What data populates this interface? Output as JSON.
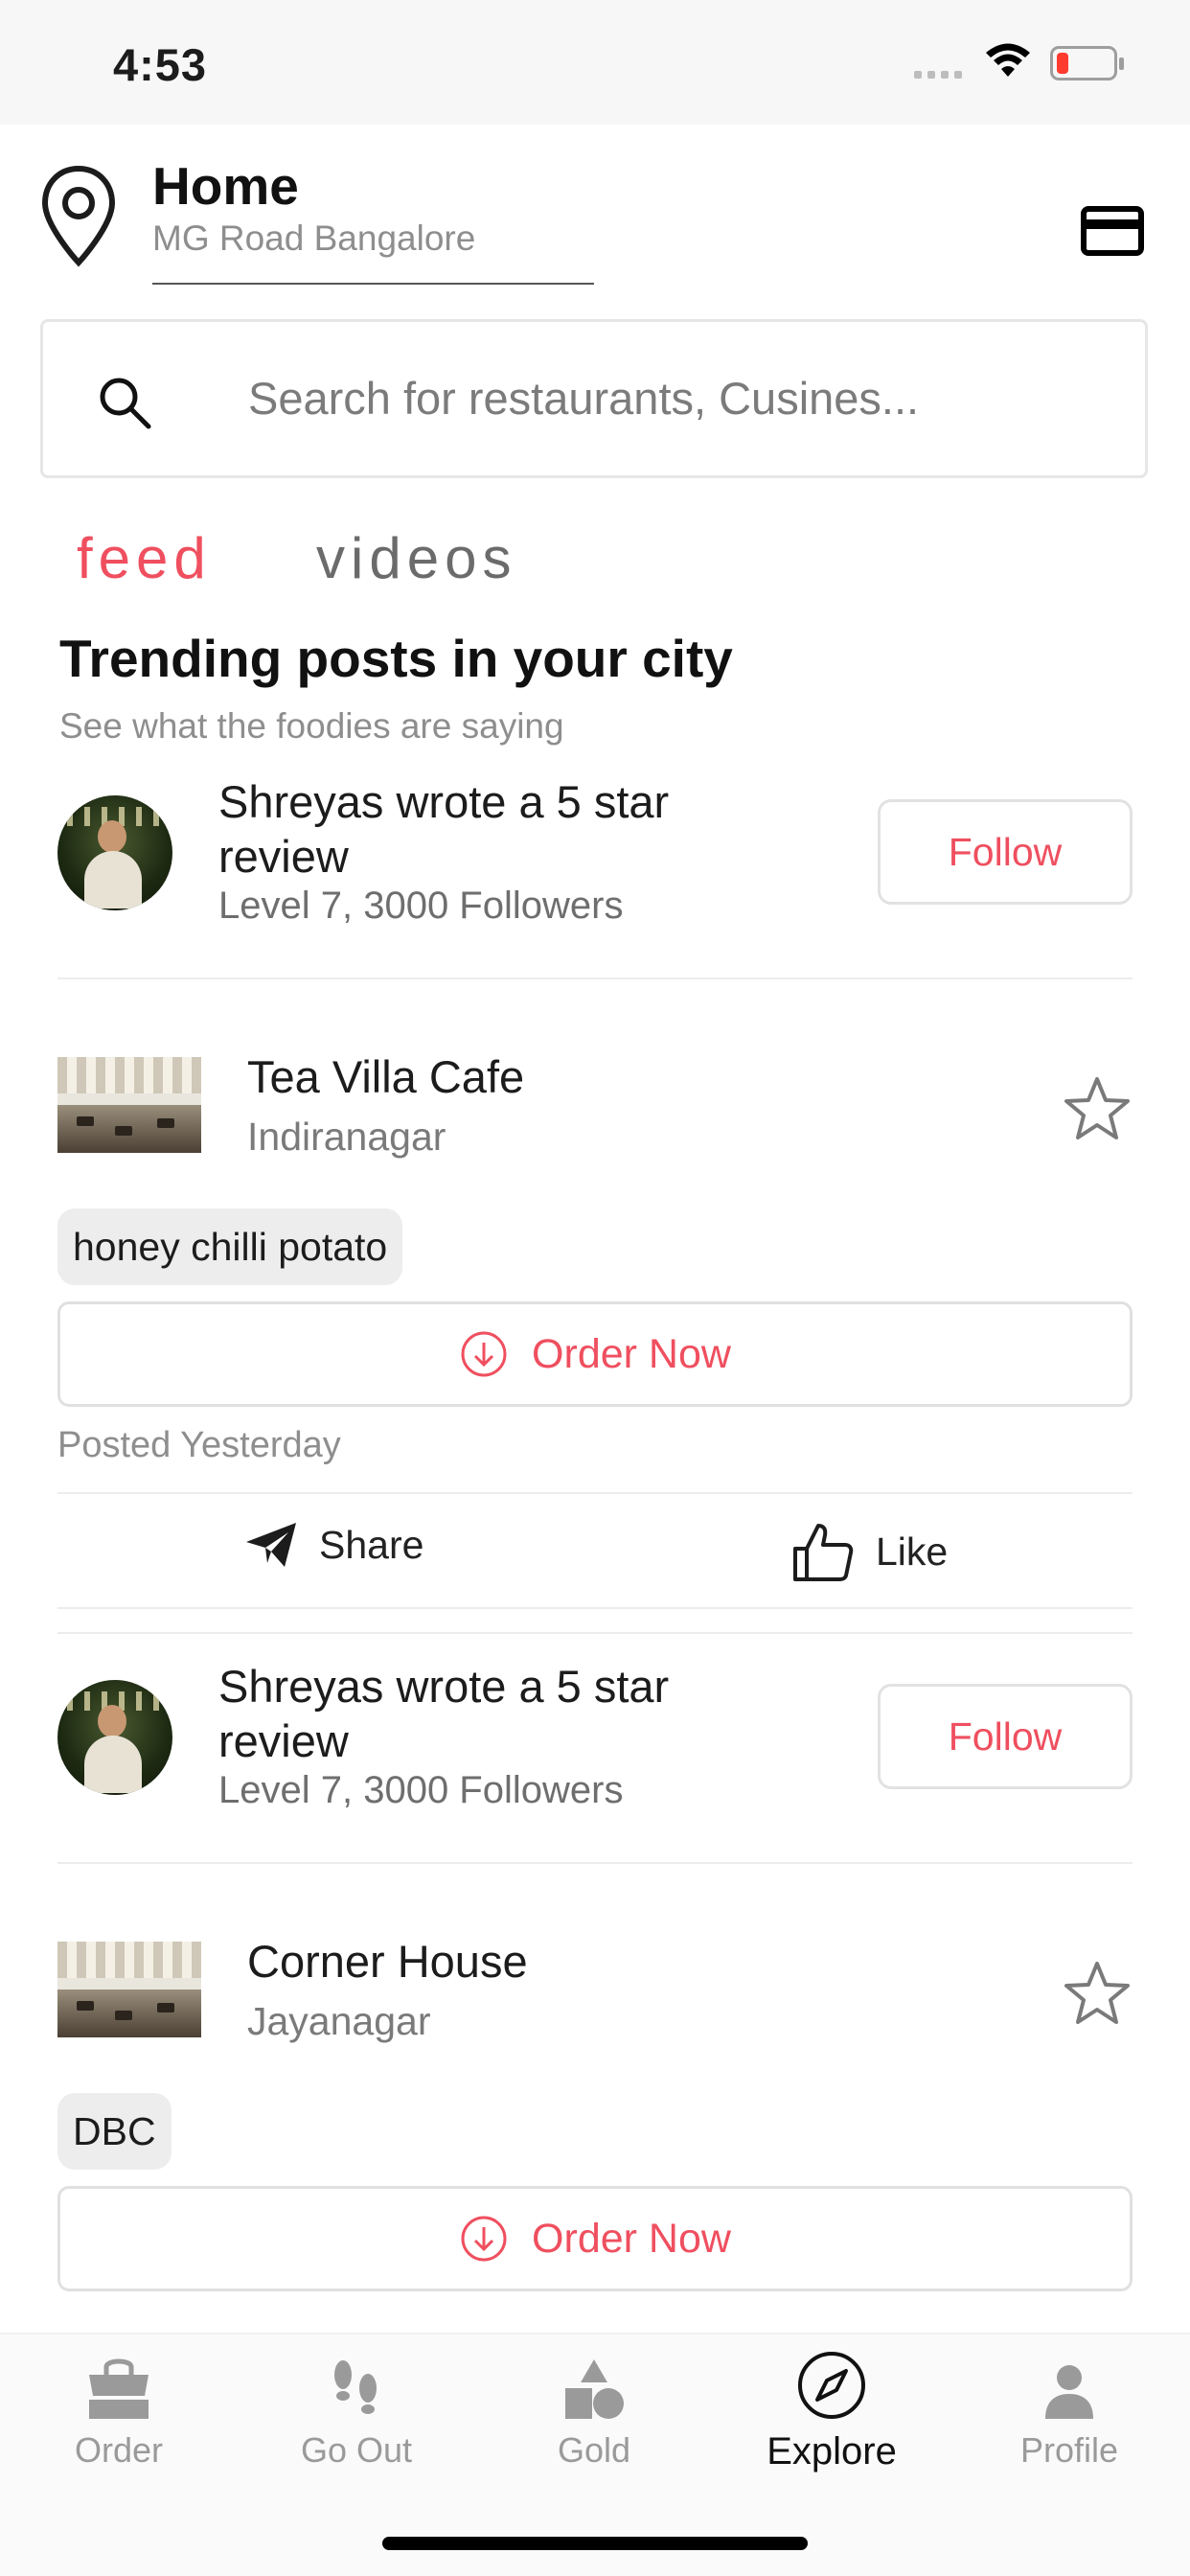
{
  "status_bar": {
    "time": "4:53"
  },
  "header": {
    "location_title": "Home",
    "location_subtitle": "MG Road Bangalore",
    "pin_icon": "location-pin-icon",
    "card_icon": "credit-card-icon"
  },
  "search": {
    "placeholder": "Search for restaurants, Cusines...",
    "icon": "search-icon"
  },
  "tabs": [
    {
      "label": "feed",
      "active": true
    },
    {
      "label": "videos",
      "active": false
    }
  ],
  "section": {
    "title": "Trending posts in your city",
    "subtitle": "See what the foodies are saying"
  },
  "posts": [
    {
      "review_text": "Shreyas wrote a 5 star review",
      "reviewer_meta": "Level 7, 3000 Followers",
      "follow_label": "Follow",
      "restaurant_name": "Tea Villa Cafe",
      "restaurant_area": "Indiranagar",
      "dish_tag": "honey chilli potato",
      "order_label": "Order Now",
      "posted": "Posted Yesterday",
      "share_label": "Share",
      "like_label": "Like"
    },
    {
      "review_text": "Shreyas wrote a 5 star review",
      "reviewer_meta": "Level 7, 3000 Followers",
      "follow_label": "Follow",
      "restaurant_name": "Corner House",
      "restaurant_area": "Jayanagar",
      "dish_tag": "DBC",
      "order_label": "Order Now"
    }
  ],
  "bottom_nav": [
    {
      "label": "Order",
      "icon": "shopping-bag-icon",
      "active": false
    },
    {
      "label": "Go Out",
      "icon": "footprints-icon",
      "active": false
    },
    {
      "label": "Gold",
      "icon": "shapes-icon",
      "active": false
    },
    {
      "label": "Explore",
      "icon": "compass-icon",
      "active": true
    },
    {
      "label": "Profile",
      "icon": "person-icon",
      "active": false
    }
  ],
  "colors": {
    "accent": "#ef4f5f",
    "muted_text": "#8e8e8e",
    "border": "#e2e2e2",
    "battery_low": "#ff3b30"
  }
}
